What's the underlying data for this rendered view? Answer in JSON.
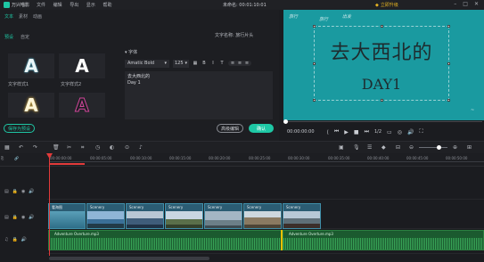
{
  "app": {
    "name": "万兴喵影",
    "menu": [
      "文件",
      "编辑",
      "导出",
      "显示",
      "帮助"
    ],
    "doc_title": "未命名: 00:01:10:01",
    "upgrade_label": "立即升级",
    "window_icons": [
      "minimize-icon",
      "maximize-icon",
      "close-icon"
    ]
  },
  "left_panel": {
    "tabs": [
      "文本",
      "素材",
      "动画"
    ],
    "active_tab": 0,
    "subtabs": [
      "预设",
      "自定"
    ],
    "active_subtab": 0,
    "presets": [
      {
        "glyph": "A",
        "label": "文字样式1"
      },
      {
        "glyph": "A",
        "label": "文字样式2"
      },
      {
        "glyph": "A",
        "label": ""
      },
      {
        "glyph": "A",
        "label": ""
      }
    ],
    "save_preset_button": "保存为预设",
    "text_name_label": "文字名称: 旅行片头",
    "settings_header": "▾ 字体",
    "font": "Amatic Bold",
    "font_size": "125",
    "format_buttons": [
      "B",
      "I",
      "T"
    ],
    "align_buttons": [
      "≡",
      "≡",
      "≡"
    ],
    "text_lines": [
      "去大西北的",
      "Day 1"
    ],
    "advanced_button": "高级编辑",
    "ok_button": "确认"
  },
  "preview": {
    "line1": "去大西北的",
    "line2": "DAY1",
    "doodles": [
      "旅行",
      "旅行",
      "出发",
      "~"
    ],
    "time": "00:00:00:00",
    "ratio": "1/2",
    "controls": [
      "prev-frame-icon",
      "rewind-icon",
      "play-icon",
      "stop-icon",
      "forward-icon"
    ],
    "right_controls": [
      "screen-icon",
      "snapshot-icon",
      "volume-icon",
      "fullscreen-icon"
    ]
  },
  "ruler_ticks": [
    "00:00:00:00",
    "00:00:05:00",
    "00:00:10:00",
    "00:00:15:00",
    "00:00:20:00",
    "00:00:25:00",
    "00:00:30:00",
    "00:00:35:00",
    "00:00:40:00",
    "00:00:45:00",
    "00:00:50:00"
  ],
  "tracks": {
    "video_clips": [
      {
        "name": "看海图"
      },
      {
        "name": "Scenery"
      },
      {
        "name": "Scenery"
      },
      {
        "name": "Scenery"
      },
      {
        "name": "Scenery"
      },
      {
        "name": "Scenery"
      },
      {
        "name": "Scenery"
      }
    ],
    "audio_clips": [
      {
        "name": "Adventure Overture.mp3"
      },
      {
        "name": "Adventure Overture.mp3"
      }
    ]
  }
}
